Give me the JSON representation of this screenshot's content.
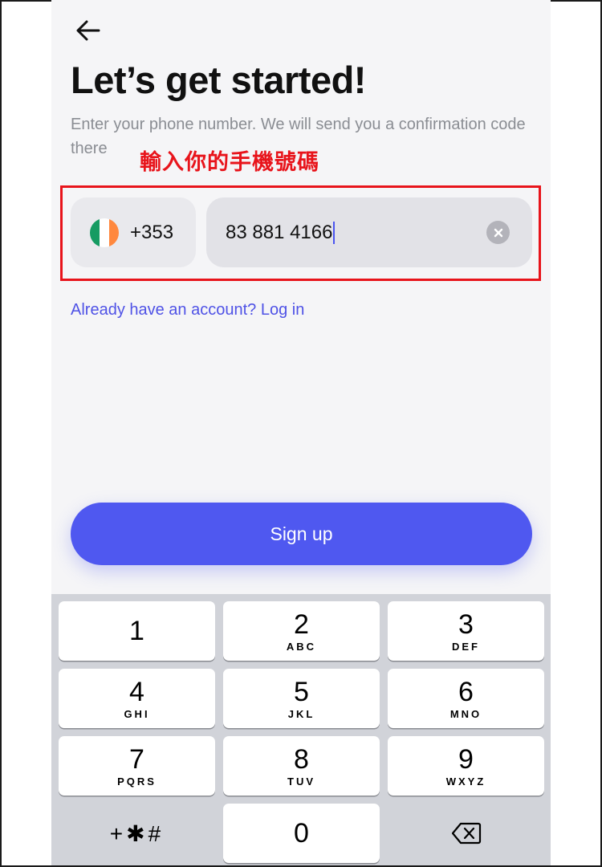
{
  "header": {
    "back_icon": "arrow-left-icon",
    "title": "Let’s get started!",
    "subtitle": "Enter your phone number. We will send you a confirmation code there"
  },
  "annotation": {
    "text": "輸入你的手機號碼",
    "color": "#e8141b"
  },
  "phone_form": {
    "country": {
      "flag_icon": "ireland-flag-icon",
      "flag_colors": [
        "#169b62",
        "#ffffff",
        "#ff883e"
      ],
      "dial_code": "+353"
    },
    "number": {
      "value": "83 881 4166",
      "clear_icon": "clear-circle-icon"
    }
  },
  "login_link": "Already have an account? Log in",
  "signup_label": "Sign up",
  "keypad": {
    "keys": [
      {
        "digit": "1",
        "letters": ""
      },
      {
        "digit": "2",
        "letters": "ABC"
      },
      {
        "digit": "3",
        "letters": "DEF"
      },
      {
        "digit": "4",
        "letters": "GHI"
      },
      {
        "digit": "5",
        "letters": "JKL"
      },
      {
        "digit": "6",
        "letters": "MNO"
      },
      {
        "digit": "7",
        "letters": "PQRS"
      },
      {
        "digit": "8",
        "letters": "TUV"
      },
      {
        "digit": "9",
        "letters": "WXYZ"
      },
      {
        "digit": "0",
        "letters": ""
      }
    ],
    "symbols": "+✱#",
    "backspace_icon": "backspace-icon"
  },
  "colors": {
    "accent": "#4f58f0",
    "link": "#4f52e6",
    "annotation": "#e8141b"
  }
}
